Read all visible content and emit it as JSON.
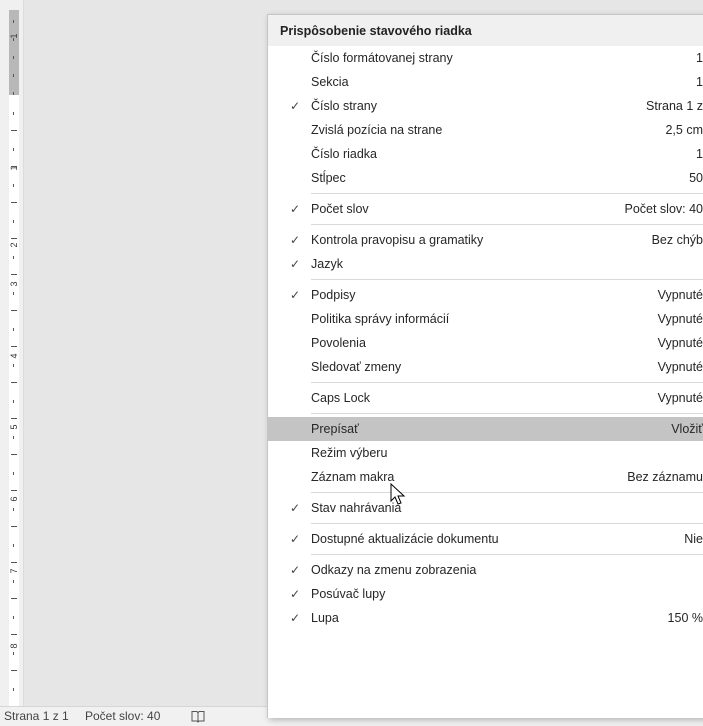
{
  "menu": {
    "title": "Prispôsobenie stavového riadka",
    "items": [
      {
        "label": "Číslo formátovanej strany",
        "value": "1",
        "checked": false
      },
      {
        "label": "Sekcia",
        "value": "1",
        "checked": false
      },
      {
        "label": "Číslo strany",
        "value": "Strana 1 z",
        "checked": true
      },
      {
        "label": "Zvislá pozícia na strane",
        "value": "2,5 cm",
        "checked": false
      },
      {
        "label": "Číslo riadka",
        "value": "1",
        "checked": false
      },
      {
        "label": "Stĺpec",
        "value": "50",
        "checked": false
      },
      {
        "label": "Počet slov",
        "value": "Počet slov: 40",
        "checked": true
      },
      {
        "label": "Kontrola pravopisu a gramatiky",
        "value": "Bez chýb",
        "checked": true
      },
      {
        "label": "Jazyk",
        "value": "",
        "checked": true
      },
      {
        "label": "Podpisy",
        "value": "Vypnuté",
        "checked": true
      },
      {
        "label": "Politika správy informácií",
        "value": "Vypnuté",
        "checked": false
      },
      {
        "label": "Povolenia",
        "value": "Vypnuté",
        "checked": false
      },
      {
        "label": "Sledovať zmeny",
        "value": "Vypnuté",
        "checked": false
      },
      {
        "label": "Caps Lock",
        "value": "Vypnuté",
        "checked": false
      },
      {
        "label": "Prepísať",
        "value": "Vložiť",
        "checked": false,
        "highlighted": true
      },
      {
        "label": "Režim výberu",
        "value": "",
        "checked": false
      },
      {
        "label": "Záznam makra",
        "value": "Bez záznamu",
        "checked": false
      },
      {
        "label": "Stav nahrávania",
        "value": "",
        "checked": true
      },
      {
        "label": "Dostupné aktualizácie dokumentu",
        "value": "Nie",
        "checked": true
      },
      {
        "label": "Odkazy na zmenu zobrazenia",
        "value": "",
        "checked": true
      },
      {
        "label": "Posúvač lupy",
        "value": "",
        "checked": true
      },
      {
        "label": "Lupa",
        "value": "150 %",
        "checked": true
      }
    ]
  },
  "statusbar": {
    "page": "Strana 1 z 1",
    "words": "Počet slov: 40",
    "proofing_icon": "proofing-book-icon"
  },
  "ruler": {
    "numbers": [
      "1",
      "1",
      "2",
      "3",
      "4",
      "5",
      "6",
      "7",
      "8"
    ]
  },
  "colors": {
    "highlight": "#c4c4c4",
    "header_bg": "#f0f0f0",
    "canvas": "#e6e6e6"
  }
}
